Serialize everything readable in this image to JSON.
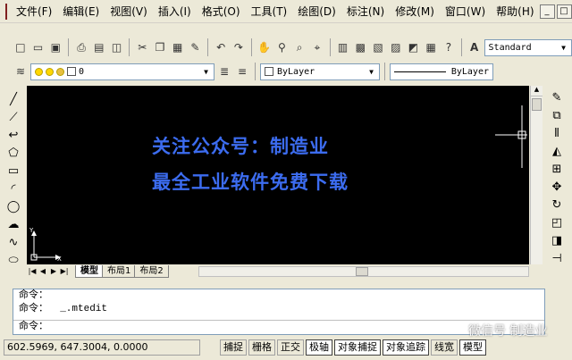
{
  "menu": [
    "文件(F)",
    "编辑(E)",
    "视图(V)",
    "插入(I)",
    "格式(O)",
    "工具(T)",
    "绘图(D)",
    "标注(N)",
    "修改(M)",
    "窗口(W)",
    "帮助(H)"
  ],
  "window_buttons": [
    "_",
    "□",
    "×"
  ],
  "toolbar": {
    "text_style": "Standard"
  },
  "layer_toolbar": {
    "layer": "0",
    "color": "ByLayer",
    "linetype": "ByLayer"
  },
  "canvas": {
    "overlay_line1": "关注公众号：制造业",
    "overlay_line2": "最全工业软件免费下载",
    "ucs_y": "Y",
    "ucs_x": "X"
  },
  "tabs": [
    "模型",
    "布局1",
    "布局2"
  ],
  "command": {
    "line1": "命令：",
    "line2": "命令：  _.mtedit",
    "line3": "命令："
  },
  "status": {
    "coords": "602.5969, 647.3004, 0.0000",
    "buttons": [
      "捕捉",
      "栅格",
      "正交",
      "极轴",
      "对象捕捉",
      "对象追踪",
      "线宽",
      "模型"
    ]
  },
  "watermark": "微信号 制造业",
  "colors": {
    "canvas": "#000000",
    "overlay_text": "#3c6cf0",
    "chrome": "#ece9d8"
  }
}
